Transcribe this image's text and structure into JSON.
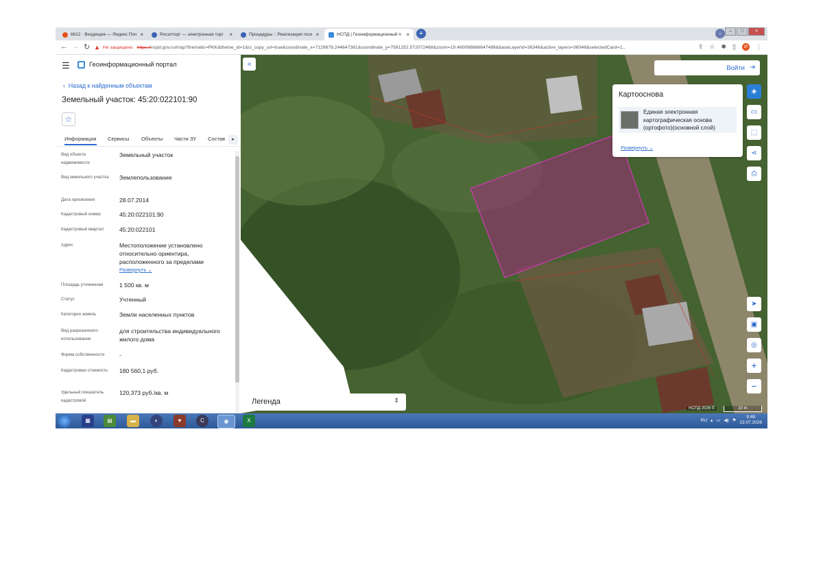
{
  "browser": {
    "tabs": [
      {
        "label": "6612 · Входящие — Яндекс Поч",
        "favicon_color": "#e8541c",
        "active": false
      },
      {
        "label": "Росэлторг — электронная торг",
        "favicon_color": "#3c64b4",
        "active": false
      },
      {
        "label": "Процедуры :: Реализация госи",
        "favicon_color": "#3c64b4",
        "active": false
      },
      {
        "label": "НСПД | Геоинформационный п",
        "favicon_color": "#3b8ad9",
        "active": true
      }
    ],
    "new_tab_label": "+",
    "security_label": "Не защищено",
    "url_scheme": "https://",
    "url_rest": "nspd.gov.ru/map?thematic=PKK&theme_id=1&is_copy_url=true&coordinate_x=7129679.244647381&coordinate_y=7581252.572072468&zoom=19.460086866647486&baseLayerId=36346&active_layers=36048&selectedCard=1...",
    "profile_initial": "И"
  },
  "portal": {
    "title": "Геоинформационный портал",
    "back_label": "Назад к найденным объектам",
    "parcel_title": "Земельный участок: 45:20:022101:90",
    "tabs": [
      "Информация",
      "Сервисы",
      "Объекты",
      "Части ЗУ",
      "Состав"
    ],
    "fields": [
      {
        "label": "Вид объекта недвижимости",
        "value": "Земельный участок"
      },
      {
        "label": "Вид земельного участка",
        "value": "Землепользование"
      },
      {
        "label": "Дата присвоения",
        "value": "28.07.2014"
      },
      {
        "label": "Кадастровый номер",
        "value": "45:20:022101:90"
      },
      {
        "label": "Кадастровый квартал",
        "value": "45:20:022101"
      },
      {
        "label": "Адрес",
        "value": "Местоположение установлено относительно ориентира, расположенного за пределами"
      },
      {
        "label": "Площадь уточненная",
        "value": "1 500 кв. м"
      },
      {
        "label": "Статус",
        "value": "Учтенный"
      },
      {
        "label": "Категория земель",
        "value": "Земли населенных пунктов"
      },
      {
        "label": "Вид разрешенного использования",
        "value": "для строительства индивидуального жилого дома"
      },
      {
        "label": "Форма собственности",
        "value": "-"
      },
      {
        "label": "Кадастровая стоимость",
        "value": "180 560,1 руб."
      },
      {
        "label": "Удельный показатель кадастровой",
        "value": "120,373 руб./кв. м"
      }
    ],
    "address_expand": "Развернуть"
  },
  "map": {
    "login_label": "Войти",
    "basemap_title": "Картооснова",
    "basemap_item": "Единая электронная картографическая основа (ортофото)(основной слой)",
    "basemap_expand": "Развернуть",
    "legend_label": "Легенда",
    "attribution": "НСПД 2026 ©",
    "scale_label": "10 m",
    "parcel_color": "#b0218c"
  },
  "taskbar": {
    "lang": "RU",
    "time": "9:49",
    "date": "22.07.2026"
  }
}
